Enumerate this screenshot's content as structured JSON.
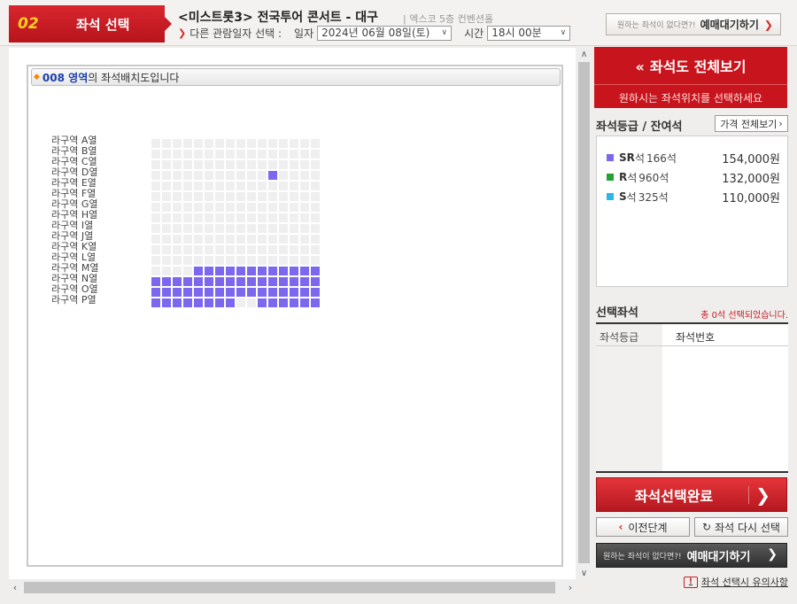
{
  "header": {
    "step_number": "02",
    "step_label": "좌석 선택",
    "show_title": "<미스트롯3> 전국투어 콘서트 - 대구",
    "venue": "| 엑스코 5층 컨벤션홀",
    "other_date_label": "다른 관람일자 선택 :",
    "date_label": "일자",
    "date_value": "2024년 06월 08일(토)",
    "time_label": "시간",
    "time_value": "18시 00분",
    "waitlist_question": "원하는 좌석이 없다면?!",
    "waitlist_label": "예매대기하기"
  },
  "map": {
    "area_name": "008 영역",
    "area_suffix": "의 좌석배치도입니다",
    "row_labels": [
      "라구역 A열",
      "라구역 B열",
      "라구역 C열",
      "라구역 D열",
      "라구역 E열",
      "라구역 F열",
      "라구역 G열",
      "라구역 H열",
      "라구역 I열",
      "라구역 J열",
      "라구역 K열",
      "라구역 L열",
      "라구역 M열",
      "라구역 N열",
      "라구역 O열",
      "라구역 P열"
    ],
    "seat_rows": [
      "0000000000000000",
      "0000000000000000",
      "0000000000000000",
      "0000000000010000",
      "0000000000000000",
      "0000000000000000",
      "0000000000000000",
      "0000000000000000",
      "0000000000000000",
      "0000000000000000",
      "0000000000000000",
      "0000000000000000",
      "0000111111111111",
      "1111111111111111",
      "1111111111111111",
      "1111111100111111"
    ],
    "colors": {
      "available": "#7b68ee",
      "unavailable": "#efefef"
    }
  },
  "side": {
    "full_map_title": "좌석도 전체보기",
    "full_map_sub": "원하시는 좌석위치를 선택하세요",
    "grade_title": "좌석등급 / 잔여석",
    "price_all_label": "가격 전체보기",
    "grades": [
      {
        "grade": "SR",
        "suffix": "석",
        "count": "166석",
        "price": "154,000원",
        "color": "#7b68ee"
      },
      {
        "grade": "R",
        "suffix": "석",
        "count": "960석",
        "price": "132,000원",
        "color": "#22a335"
      },
      {
        "grade": "S",
        "suffix": "석",
        "count": "325석",
        "price": "110,000원",
        "color": "#29b6e8"
      }
    ],
    "selected_title": "선택좌석",
    "selected_status": "총 0석 선택되었습니다.",
    "col_grade": "좌석등급",
    "col_seat": "좌석번호",
    "complete_label": "좌석선택완료",
    "prev_label": "이전단계",
    "reset_label": "좌석 다시 선택",
    "waitlist_question": "원하는 좌석이 없다면?!",
    "waitlist_label": "예매대기하기",
    "caution_label": "좌석 선택시 유의사항"
  }
}
